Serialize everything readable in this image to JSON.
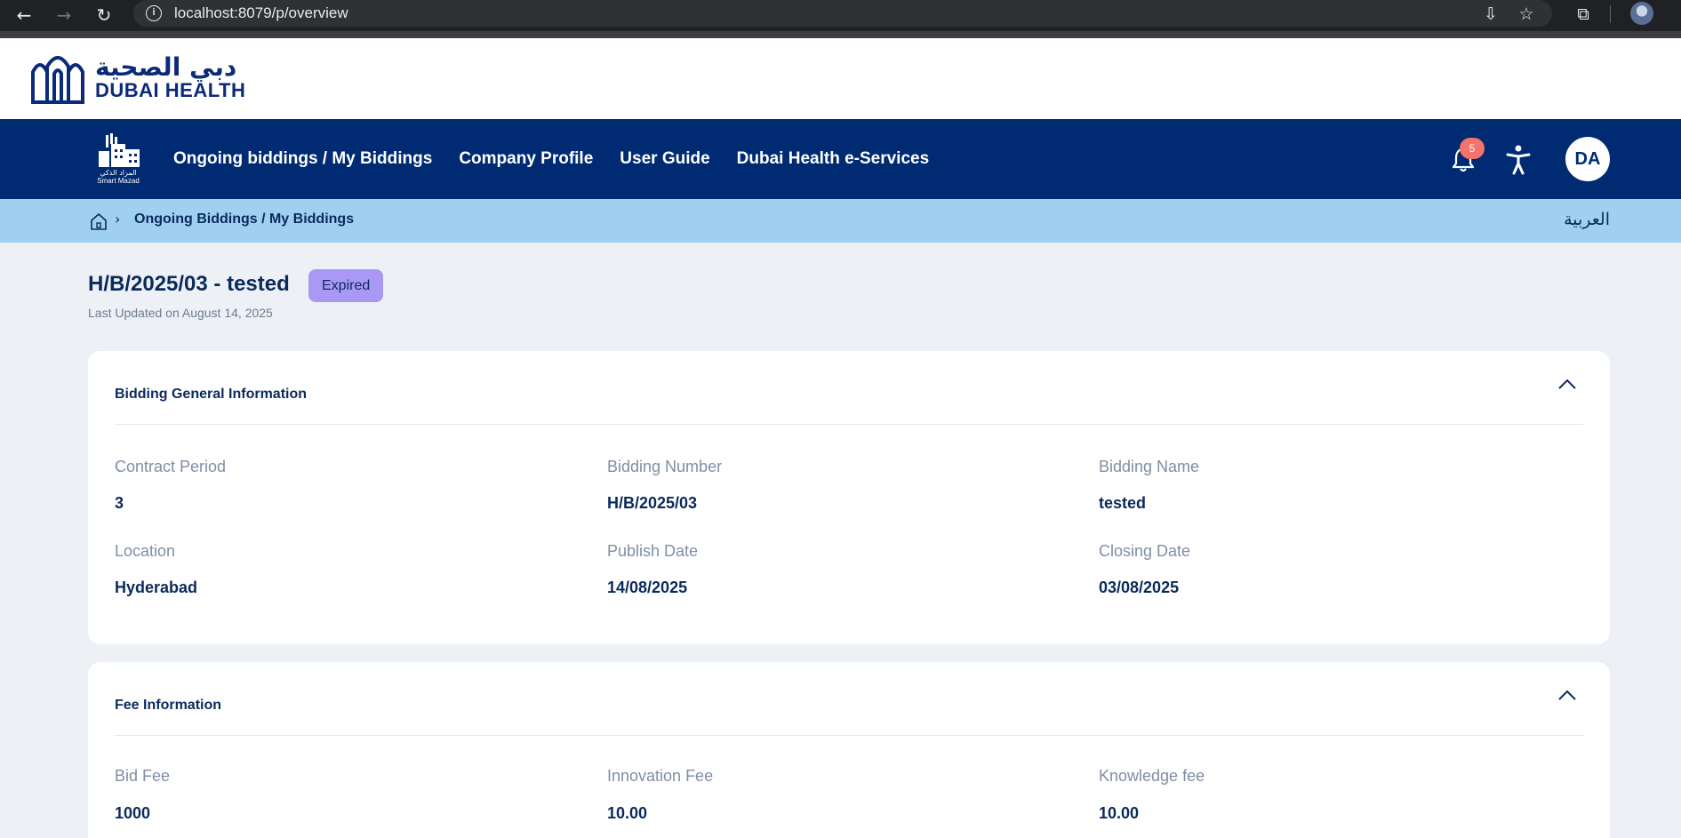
{
  "browser": {
    "url": "localhost:8079/p/overview"
  },
  "header": {
    "logo_ar": "دبي الصحية",
    "logo_en": "DUBAI HEALTH"
  },
  "nav": {
    "mazad_ar": "المزاد الذكي",
    "mazad_en": "Smart Mazad",
    "links": [
      "Ongoing biddings / My Biddings",
      "Company Profile",
      "User Guide",
      "Dubai Health e-Services"
    ],
    "notification_count": "5",
    "avatar_initials": "DA"
  },
  "breadcrumb": {
    "current": "Ongoing Biddings / My Biddings",
    "language_toggle": "العربية"
  },
  "page": {
    "title": "H/B/2025/03 - tested",
    "status": "Expired",
    "last_updated": "Last Updated on August 14, 2025"
  },
  "general_info": {
    "title": "Bidding General Information",
    "fields": [
      {
        "label": "Contract Period",
        "value": "3"
      },
      {
        "label": "Bidding Number",
        "value": "H/B/2025/03"
      },
      {
        "label": "Bidding Name",
        "value": "tested"
      },
      {
        "label": "Location",
        "value": "Hyderabad"
      },
      {
        "label": "Publish Date",
        "value": "14/08/2025"
      },
      {
        "label": "Closing Date",
        "value": "03/08/2025"
      }
    ]
  },
  "fee_info": {
    "title": "Fee Information",
    "fields": [
      {
        "label": "Bid Fee",
        "value": "1000"
      },
      {
        "label": "Innovation Fee",
        "value": "10.00"
      },
      {
        "label": "Knowledge fee",
        "value": "10.00"
      }
    ]
  },
  "colors": {
    "nav_bg": "#002b73",
    "breadcrumb_bg": "#9fd0f0",
    "page_bg": "#edf1f6",
    "badge_bg": "#a999f4",
    "notification_badge": "#f4736b"
  }
}
